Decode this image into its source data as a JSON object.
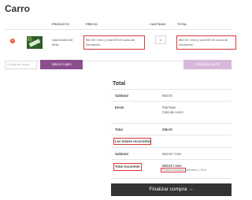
{
  "page": {
    "title": "Carro"
  },
  "cart": {
    "columns": {
      "product": "PRODUCTO",
      "price": "PRECIO",
      "quantity": "CANTIDAD",
      "total": "TOTAL"
    },
    "row": {
      "remove_symbol": "×",
      "product_name": "Una lección de tenis",
      "price": "€60.00 / mes y una €25.00 cuota de inscripción",
      "quantity": "1",
      "total": "€60.00 / mes y una €25.00 cuota de inscripción"
    }
  },
  "coupon": {
    "placeholder": "Código de cupón",
    "apply_label": "Aplicar cupón"
  },
  "update_label": "Actualizar carrito",
  "totals": {
    "title": "Total",
    "subtotal_label": "Subtotal",
    "subtotal_value": "€60.00",
    "shipping_label": "Envío",
    "shipping_value": "Flat Rate",
    "shipping_link": "Calcular envío",
    "total_label": "Total",
    "total_value": "€85.00",
    "recurring_heading": "Los totales recurrentes",
    "recurring_subtotal_label": "Subtotal",
    "recurring_subtotal_value": "€60.00 / mes",
    "recurring_total_label": "Total recurrente",
    "recurring_total_value": "€60.00 / mes",
    "first_renewal": "Primera renovación: November 2, 2016"
  },
  "checkout_label": "Finalizar compra →"
}
